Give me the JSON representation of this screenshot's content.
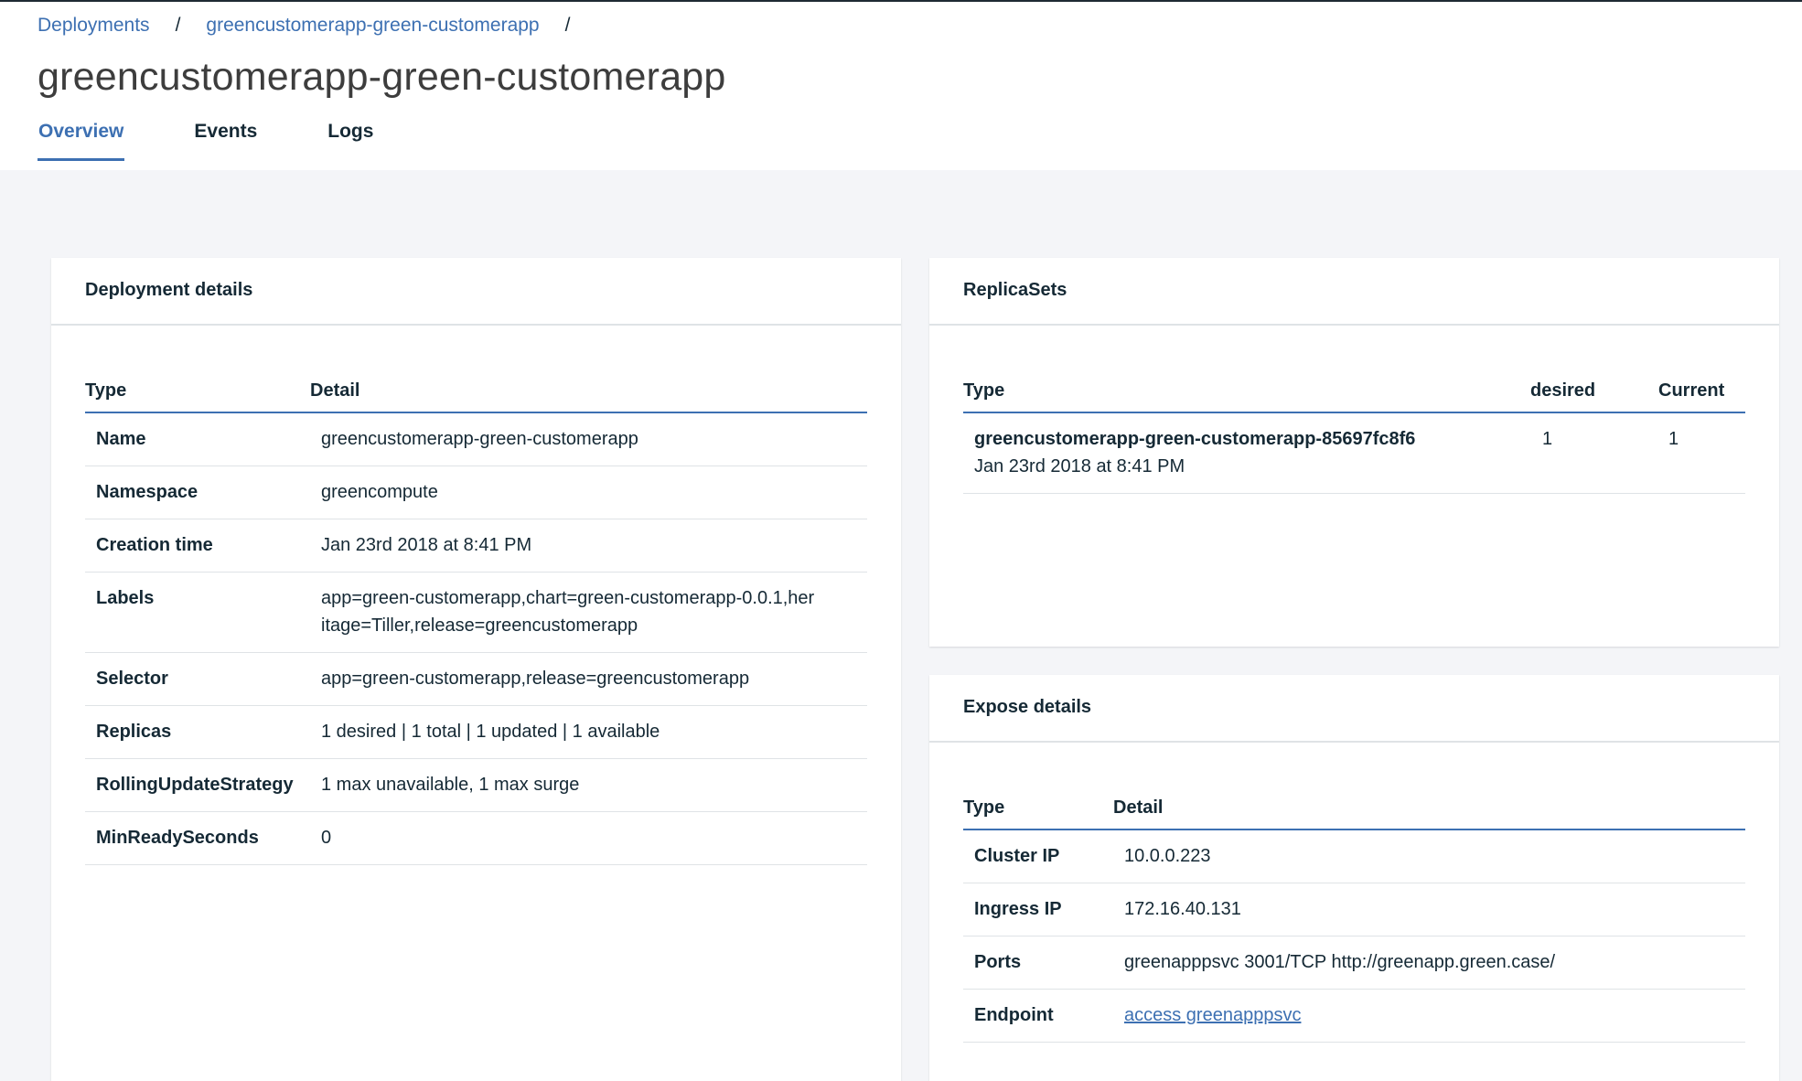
{
  "breadcrumb": {
    "items": [
      "Deployments",
      "greencustomerapp-green-customerapp"
    ],
    "separator": "/"
  },
  "page_title": "greencustomerapp-green-customerapp",
  "tabs": [
    {
      "label": "Overview",
      "active": true
    },
    {
      "label": "Events",
      "active": false
    },
    {
      "label": "Logs",
      "active": false
    }
  ],
  "deployment_details": {
    "title": "Deployment details",
    "headers": [
      "Type",
      "Detail"
    ],
    "rows": [
      {
        "key": "Name",
        "value": "greencustomerapp-green-customerapp"
      },
      {
        "key": "Namespace",
        "value": "greencompute"
      },
      {
        "key": "Creation time",
        "value": "Jan 23rd 2018 at 8:41 PM"
      },
      {
        "key": "Labels",
        "value": "app=green-customerapp,chart=green-customerapp-0.0.1,her",
        "value2": "itage=Tiller,release=greencustomerapp"
      },
      {
        "key": "Selector",
        "value": "app=green-customerapp,release=greencustomerapp"
      },
      {
        "key": "Replicas",
        "value": "1 desired | 1 total | 1 updated | 1 available"
      },
      {
        "key": "RollingUpdateStrategy",
        "value": "1 max unavailable, 1 max surge"
      },
      {
        "key": "MinReadySeconds",
        "value": "0"
      }
    ]
  },
  "replicasets": {
    "title": "ReplicaSets",
    "headers": [
      "Type",
      "desired",
      "Current"
    ],
    "rows": [
      {
        "name": "greencustomerapp-green-customerapp-85697fc8f6",
        "created": "Jan 23rd 2018 at 8:41 PM",
        "desired": "1",
        "current": "1"
      }
    ]
  },
  "expose_details": {
    "title": "Expose details",
    "headers": [
      "Type",
      "Detail"
    ],
    "rows": [
      {
        "key": "Cluster IP",
        "value": "10.0.0.223"
      },
      {
        "key": "Ingress IP",
        "value": "172.16.40.131"
      },
      {
        "key": "Ports",
        "value": "greenapppsvc 3001/TCP http://greenapp.green.case/"
      },
      {
        "key": "Endpoint",
        "value": "access greenapppsvc",
        "is_link": true
      }
    ]
  },
  "colors": {
    "accent": "#3d70b2",
    "text": "#152935",
    "background": "#f4f5f8"
  }
}
